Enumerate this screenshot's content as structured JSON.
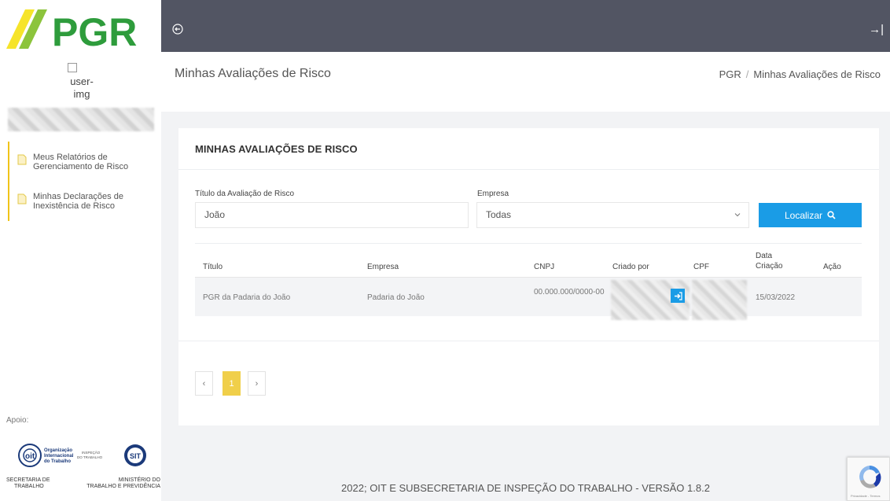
{
  "logo": {
    "text": "PGR"
  },
  "user": {
    "img_alt": "user-img"
  },
  "sidebar": {
    "items": [
      {
        "label": "Meus Relatórios de Gerenciamento de Risco"
      },
      {
        "label": "Minhas Declarações de Inexistência de Risco"
      }
    ],
    "apoio_label": "Apoio:",
    "partners": {
      "oit": "Organização Internacional do Trabalho",
      "sit_small": "INSPEÇÃO DO TRABALHO",
      "sit": "SIT"
    },
    "ministerio_left": [
      "SECRETARIA DE",
      "TRABALHO"
    ],
    "ministerio_right": [
      "MINISTÉRIO DO",
      "TRABALHO E PREVIDÊNCIA"
    ]
  },
  "topbar": {
    "expand_icon": "→|"
  },
  "page": {
    "title": "Minhas Avaliações de Risco"
  },
  "breadcrumb": {
    "root": "PGR",
    "separator": "/",
    "current": "Minhas Avaliações de Risco"
  },
  "card": {
    "title": "MINHAS AVALIAÇÕES DE RISCO",
    "filters": {
      "titulo_label": "Título da Avaliação de Risco",
      "titulo_value": "João",
      "empresa_label": "Empresa",
      "empresa_value": "Todas",
      "search_button": "Localizar"
    },
    "table": {
      "headers": [
        "Título",
        "Empresa",
        "CNPJ",
        "Criado por",
        "CPF",
        "Data Criação",
        "Ação"
      ],
      "rows": [
        {
          "titulo": "PGR da Padaria do João",
          "empresa": "Padaria do João",
          "cnpj": "00.000.000/0000-00",
          "data": "15/03/2022"
        }
      ]
    },
    "pagination": {
      "prev": "‹",
      "current": "1",
      "next": "›"
    }
  },
  "footer": {
    "text": "2022; OIT E SUBSECRETARIA DE INSPEÇÃO DO TRABALHO - VERSÃO 1.8.2"
  },
  "recaptcha": {
    "text": "Privacidade - Termos"
  },
  "colors": {
    "accent": "#1a9ce6",
    "yellow": "#f0cf4a",
    "green": "#2e9c3c",
    "topbar": "#525563"
  }
}
